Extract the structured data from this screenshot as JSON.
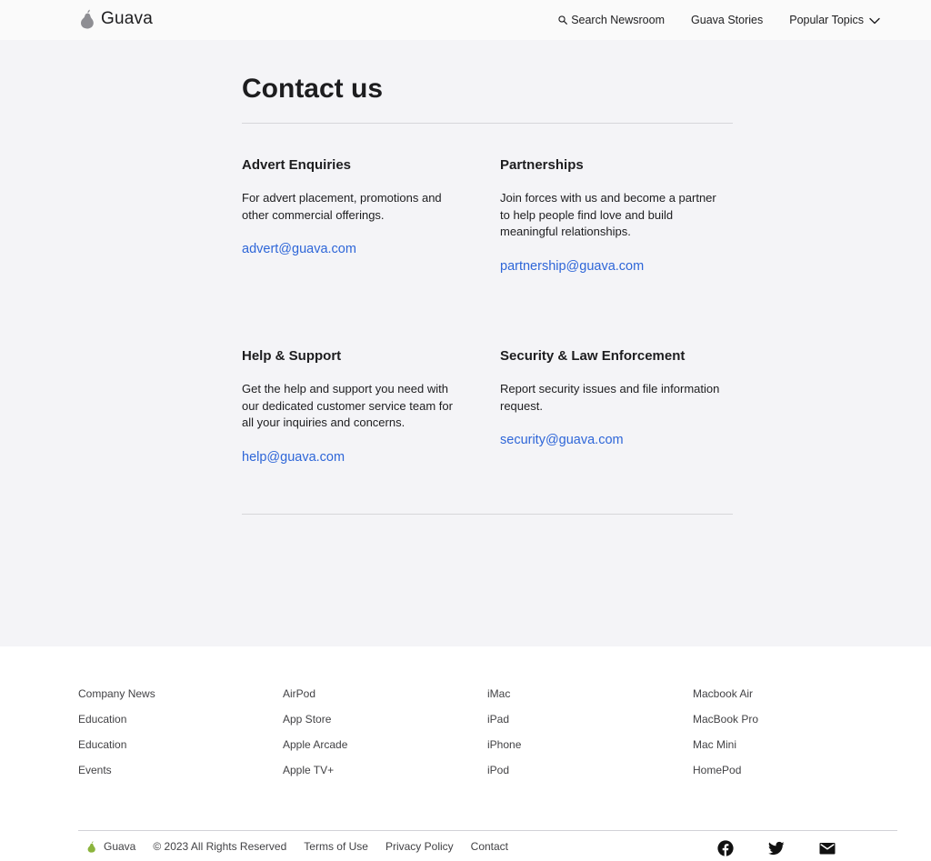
{
  "header": {
    "brand": "Guava",
    "nav": {
      "search": "Search Newsroom",
      "stories": "Guava Stories",
      "topics": "Popular Topics"
    }
  },
  "main": {
    "title": "Contact us",
    "cards": [
      {
        "heading": "Advert Enquiries",
        "body": "For advert placement, promotions and other commercial offerings.",
        "email": "advert@guava.com"
      },
      {
        "heading": "Partnerships",
        "body": "Join forces with us and become a partner to help people find love and build meaningful relationships.",
        "email": "partnership@guava.com"
      },
      {
        "heading": "Help & Support",
        "body": "Get the help and support you need with our dedicated customer service team for all your inquiries and concerns.",
        "email": "help@guava.com"
      },
      {
        "heading": "Security & Law Enforcement",
        "body": "Report security issues and file information request.",
        "email": "security@guava.com"
      }
    ]
  },
  "footer": {
    "columns": [
      [
        "Company News",
        "Education",
        "Education",
        "Events"
      ],
      [
        "AirPod",
        "App Store",
        "Apple Arcade",
        "Apple TV+"
      ],
      [
        "iMac",
        "iPad",
        "iPhone",
        "iPod"
      ],
      [
        "Macbook Air",
        "MacBook Pro",
        "Mac Mini",
        "HomePod"
      ]
    ],
    "brand": "Guava",
    "copyright": "© 2023 All Rights Reserved",
    "terms": "Terms of Use",
    "privacy": "Privacy Policy",
    "contact": "Contact",
    "social_icons": [
      "facebook-icon",
      "twitter-icon",
      "mail-icon"
    ]
  },
  "colors": {
    "link": "#2e66d8",
    "page_bg": "#f4f4f7",
    "logo_gray": "#8e8e93",
    "logo_green": "#8bb43c"
  }
}
